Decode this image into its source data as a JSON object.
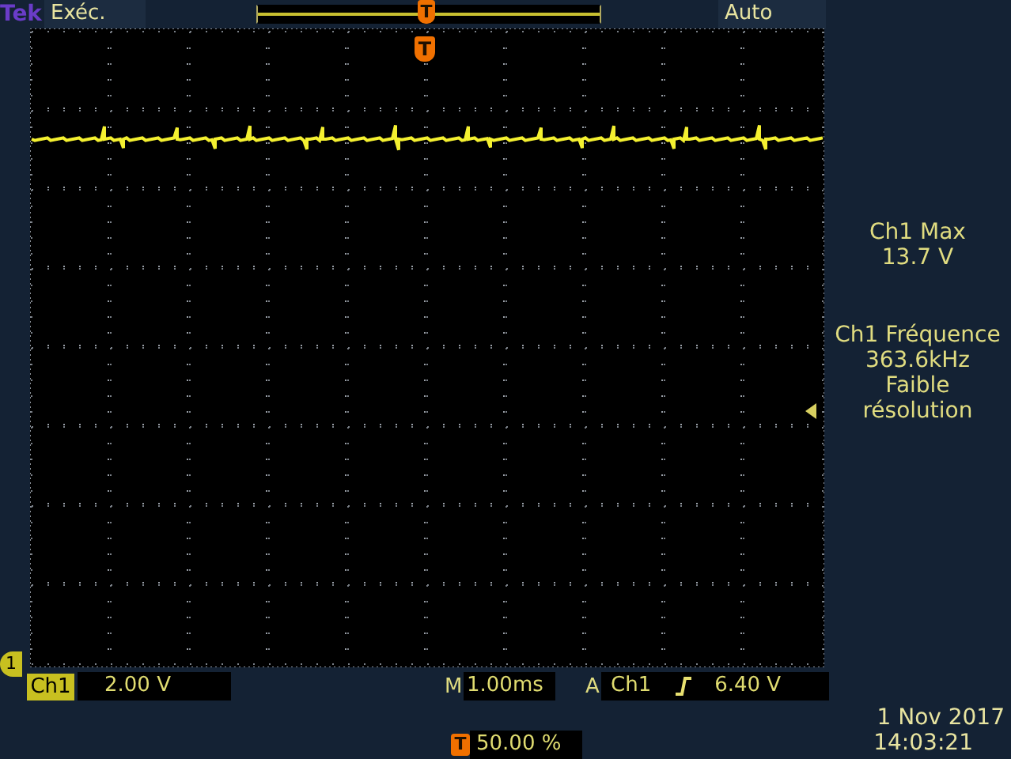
{
  "brand": "Tek",
  "run_state": "Exéc.",
  "trigger_mode": "Auto",
  "record_marker": "T",
  "trigger_marker": "T",
  "measurements": [
    {
      "lines": [
        "Ch1 Max",
        "13.7 V"
      ]
    },
    {
      "lines": [
        "Ch1 Fréquence",
        "363.6kHz",
        "Faible",
        "résolution"
      ]
    }
  ],
  "channel_marker": "1",
  "channel": {
    "label": "Ch1",
    "scale": "2.00 V"
  },
  "timebase": {
    "prefix": "M",
    "value": "1.00ms"
  },
  "trigger": {
    "prefix": "A",
    "source": "Ch1",
    "level": "6.40 V"
  },
  "trigger_position": {
    "marker": "T",
    "value": "50.00 %"
  },
  "date": "1 Nov 2017",
  "time": "14:03:21"
}
